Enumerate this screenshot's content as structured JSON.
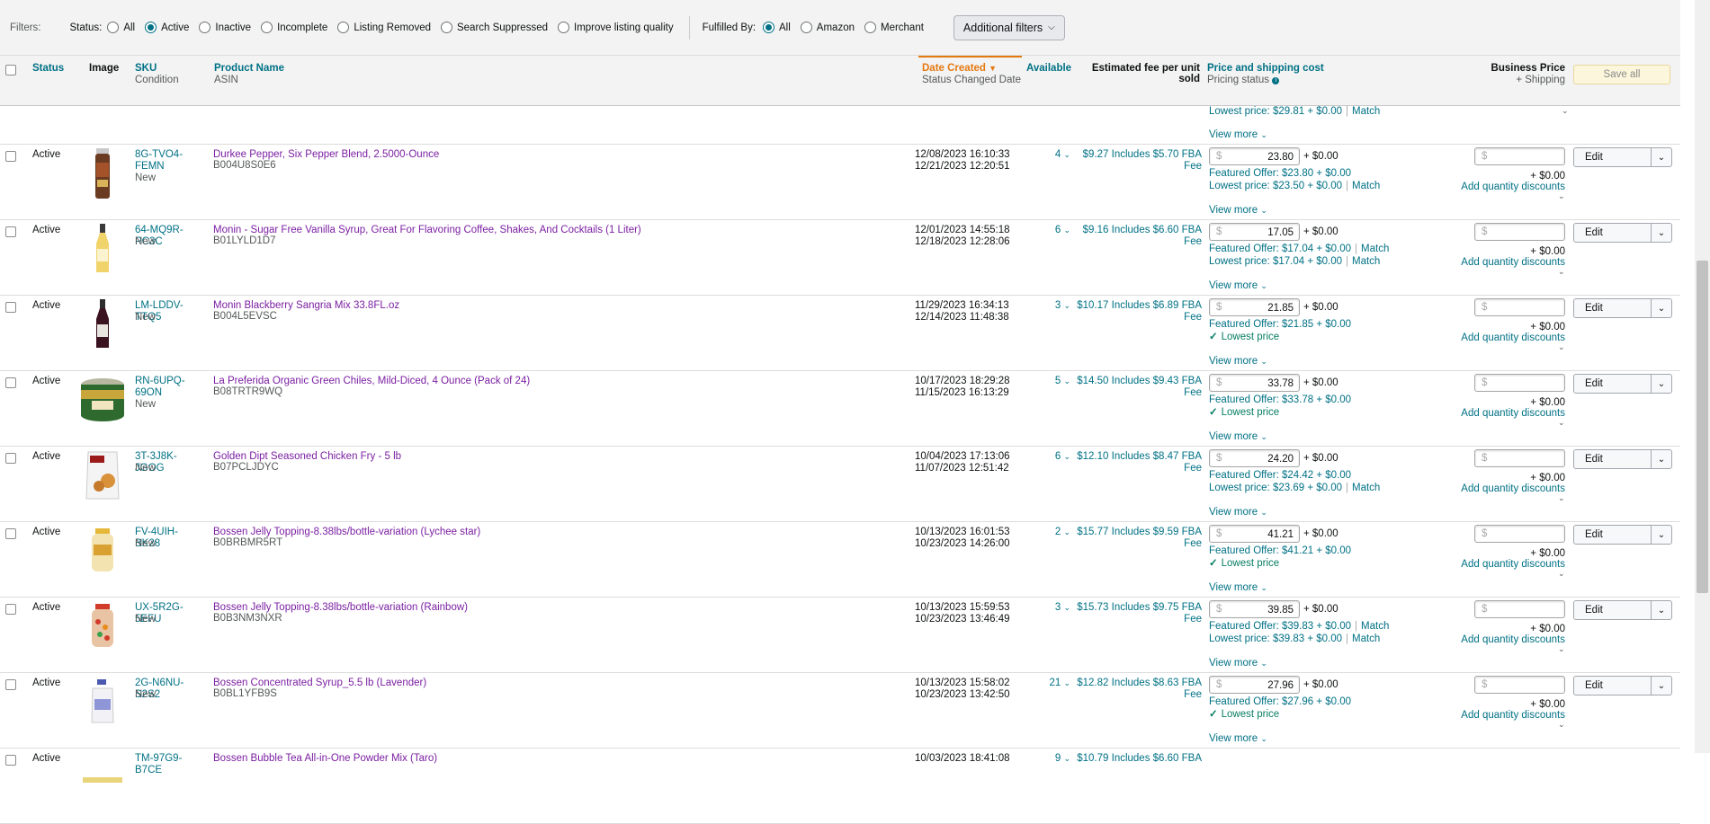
{
  "filters": {
    "label": "Filters:",
    "status_label": "Status:",
    "status_options": [
      {
        "label": "All",
        "selected": false
      },
      {
        "label": "Active",
        "selected": true
      },
      {
        "label": "Inactive",
        "selected": false
      },
      {
        "label": "Incomplete",
        "selected": false
      },
      {
        "label": "Listing Removed",
        "selected": false
      },
      {
        "label": "Search Suppressed",
        "selected": false
      },
      {
        "label": "Improve listing quality",
        "selected": false
      }
    ],
    "fulfilled_label": "Fulfilled By:",
    "fulfilled_options": [
      {
        "label": "All",
        "selected": true
      },
      {
        "label": "Amazon",
        "selected": false
      },
      {
        "label": "Merchant",
        "selected": false
      }
    ],
    "additional_filters": "Additional filters"
  },
  "header": {
    "status": "Status",
    "image": "Image",
    "sku": "SKU",
    "condition": "Condition",
    "product_name": "Product Name",
    "asin": "ASIN",
    "date_created": "Date Created",
    "status_changed": "Status Changed Date",
    "available": "Available",
    "fee_1": "Estimated fee per unit",
    "fee_2": "sold",
    "price_ship": "Price and shipping cost",
    "pricing_status": "Pricing status",
    "business_price": "Business Price",
    "plus_shipping": "+ Shipping",
    "save_all": "Save all"
  },
  "prev_row": {
    "lowest": "Lowest price: $29.81 + $0.00",
    "match": "Match",
    "view_more": "View more"
  },
  "common": {
    "currency": "$",
    "ship": "+ $0.00",
    "view_more": "View more",
    "edit": "Edit",
    "add_qty": "Add quantity discounts",
    "lowest_price": "Lowest price",
    "match": "Match"
  },
  "rows": [
    {
      "status": "Active",
      "sku": "8G-TVO4-\nFEMN",
      "condition": "New",
      "name": "Durkee Pepper, Six Pepper Blend, 2.5000-Ounce",
      "asin": "B004U8S0E6",
      "created": "12/08/2023 16:10:33",
      "changed": "12/21/2023 12:20:51",
      "available": "4",
      "fee": "$9.27 Includes $5.70 FBA",
      "fee2": "Fee",
      "price": "23.80",
      "featured": "Featured Offer: $23.80 + $0.00",
      "lowest": "Lowest price: $23.50 + $0.00",
      "featured_match": false,
      "lowest_match": true,
      "is_lowest": false,
      "img": "pepper"
    },
    {
      "status": "Active",
      "sku": "64-MQ9R-PC3C",
      "condition": "New",
      "name": "Monin - Sugar Free Vanilla Syrup, Great For Flavoring Coffee, Shakes, And Cocktails (1 Liter)",
      "asin": "B01LYLD1D7",
      "created": "12/01/2023 14:55:18",
      "changed": "12/18/2023 12:28:06",
      "available": "6",
      "fee": "$9.16 Includes $6.60 FBA",
      "fee2": "Fee",
      "price": "17.05",
      "featured": "Featured Offer: $17.04 + $0.00",
      "lowest": "Lowest price: $17.04 + $0.00",
      "featured_match": true,
      "lowest_match": true,
      "is_lowest": false,
      "img": "vanilla"
    },
    {
      "status": "Active",
      "sku": "LM-LDDV-TTQ5",
      "condition": "New",
      "name": "Monin Blackberry Sangria Mix 33.8FL.oz",
      "asin": "B004L5EVSC",
      "created": "11/29/2023 16:34:13",
      "changed": "12/14/2023 11:48:38",
      "available": "3",
      "fee": "$10.17 Includes $6.89 FBA",
      "fee2": "Fee",
      "price": "21.85",
      "featured": "Featured Offer: $21.85 + $0.00",
      "lowest": "",
      "featured_match": false,
      "lowest_match": false,
      "is_lowest": true,
      "img": "sangria"
    },
    {
      "status": "Active",
      "sku": "RN-6UPQ-\n69ON",
      "condition": "New",
      "name": "La Preferida Organic Green Chiles, Mild-Diced, 4 Ounce (Pack of 24)",
      "asin": "B08TRTR9WQ",
      "created": "10/17/2023 18:29:28",
      "changed": "11/15/2023 16:13:29",
      "available": "5",
      "fee": "$14.50 Includes $9.43 FBA",
      "fee2": "Fee",
      "price": "33.78",
      "featured": "Featured Offer: $33.78 + $0.00",
      "lowest": "",
      "featured_match": false,
      "lowest_match": false,
      "is_lowest": true,
      "img": "can"
    },
    {
      "status": "Active",
      "sku": "3T-3J8K-JGOG",
      "condition": "New",
      "name": "Golden Dipt Seasoned Chicken Fry - 5 lb",
      "asin": "B07PCLJDYC",
      "created": "10/04/2023 17:13:06",
      "changed": "11/07/2023 12:51:42",
      "available": "6",
      "fee": "$12.10 Includes $8.47 FBA",
      "fee2": "Fee",
      "price": "24.20",
      "featured": "Featured Offer: $24.42 + $0.00",
      "lowest": "Lowest price: $23.69 + $0.00",
      "featured_match": false,
      "lowest_match": true,
      "is_lowest": false,
      "img": "bag"
    },
    {
      "status": "Active",
      "sku": "FV-4UIH-BK28",
      "condition": "New",
      "name": "Bossen Jelly Topping-8.38lbs/bottle-variation (Lychee star)",
      "asin": "B0BRBMR5RT",
      "created": "10/13/2023 16:01:53",
      "changed": "10/23/2023 14:26:00",
      "available": "2",
      "fee": "$15.77 Includes $9.59 FBA",
      "fee2": "Fee",
      "price": "41.21",
      "featured": "Featured Offer: $41.21 + $0.00",
      "lowest": "",
      "featured_match": false,
      "lowest_match": false,
      "is_lowest": true,
      "img": "jar"
    },
    {
      "status": "Active",
      "sku": "UX-5R2G-5EFU",
      "condition": "New",
      "name": "Bossen Jelly Topping-8.38lbs/bottle-variation (Rainbow)",
      "asin": "B0B3NM3NXR",
      "created": "10/13/2023 15:59:53",
      "changed": "10/23/2023 13:46:49",
      "available": "3",
      "fee": "$15.73 Includes $9.75 FBA",
      "fee2": "Fee",
      "price": "39.85",
      "featured": "Featured Offer: $39.83 + $0.00",
      "lowest": "Lowest price: $39.83 + $0.00",
      "featured_match": true,
      "lowest_match": true,
      "is_lowest": false,
      "img": "rainbow"
    },
    {
      "status": "Active",
      "sku": "2G-N6NU-S2S2",
      "condition": "New",
      "name": "Bossen Concentrated Syrup_5.5 lb (Lavender)",
      "asin": "B0BL1YFB9S",
      "created": "10/13/2023 15:58:02",
      "changed": "10/23/2023 13:42:50",
      "available": "21",
      "fee": "$12.82 Includes $8.63 FBA",
      "fee2": "Fee",
      "price": "27.96",
      "featured": "Featured Offer: $27.96 + $0.00",
      "lowest": "",
      "featured_match": false,
      "lowest_match": false,
      "is_lowest": true,
      "img": "jug"
    },
    {
      "status": "Active",
      "sku": "TM-97G9-B7CE",
      "condition": "",
      "name": "Bossen Bubble Tea All-in-One Powder Mix (Taro)",
      "asin": "",
      "created": "10/03/2023 18:41:08",
      "changed": "",
      "available": "9",
      "fee": "$10.79 Includes $6.60 FBA",
      "fee2": "",
      "price": "",
      "featured": "",
      "lowest": "",
      "featured_match": false,
      "lowest_match": false,
      "is_lowest": false,
      "img": "none"
    }
  ]
}
